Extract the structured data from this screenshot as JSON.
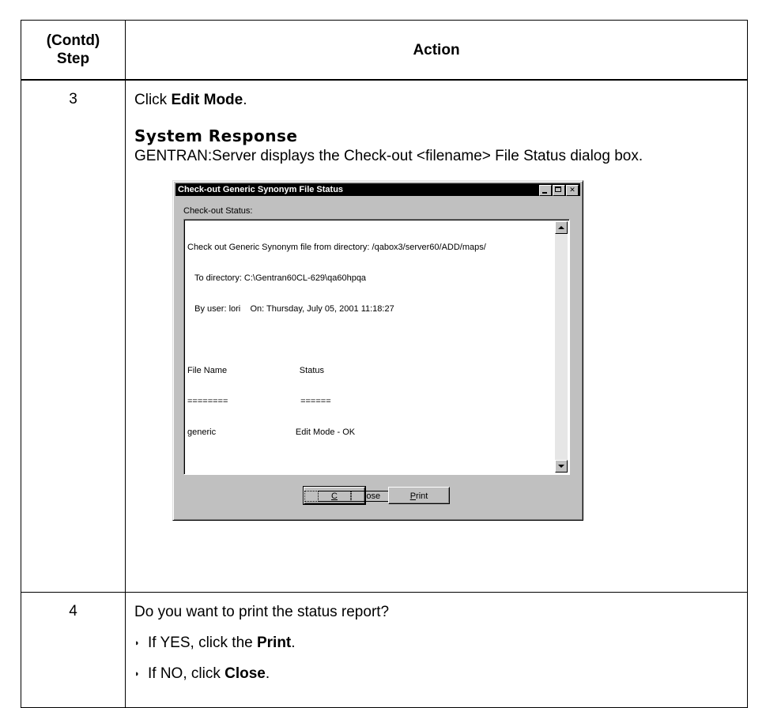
{
  "table": {
    "header_step": "(Contd)\nStep",
    "header_step_line1": "(Contd)",
    "header_step_line2": "Step",
    "header_action": "Action"
  },
  "step3": {
    "number": "3",
    "instruction_prefix": "Click ",
    "instruction_bold": "Edit Mode",
    "instruction_suffix": ".",
    "system_response_heading": "System Response",
    "system_response_text": "GENTRAN:Server displays the Check-out <filename> File Status dialog box."
  },
  "dialog": {
    "title": "Check-out Generic Synonym File Status",
    "status_label": "Check-out Status:",
    "lines": [
      "Check out Generic Synonym file from directory: /qabox3/server60/ADD/maps/",
      "   To directory: C:\\Gentran60CL-629\\qa60hpqa",
      "   By user: lori    On: Thursday, July 05, 2001 11:18:27",
      "",
      "File Name                              Status",
      "========                              ======",
      "generic                                 Edit Mode - OK"
    ],
    "close_button": "Close",
    "close_mnemonic": "C",
    "close_rest": "lose",
    "print_button": "Print",
    "print_mnemonic": "P",
    "print_rest": "rint"
  },
  "step4": {
    "number": "4",
    "question": "Do you want to print the status report?",
    "bullet_yes_prefix": "If YES, click the ",
    "bullet_yes_bold": "Print",
    "bullet_yes_suffix": ".",
    "bullet_no_prefix": "If NO, click ",
    "bullet_no_bold": "Close",
    "bullet_no_suffix": "."
  }
}
